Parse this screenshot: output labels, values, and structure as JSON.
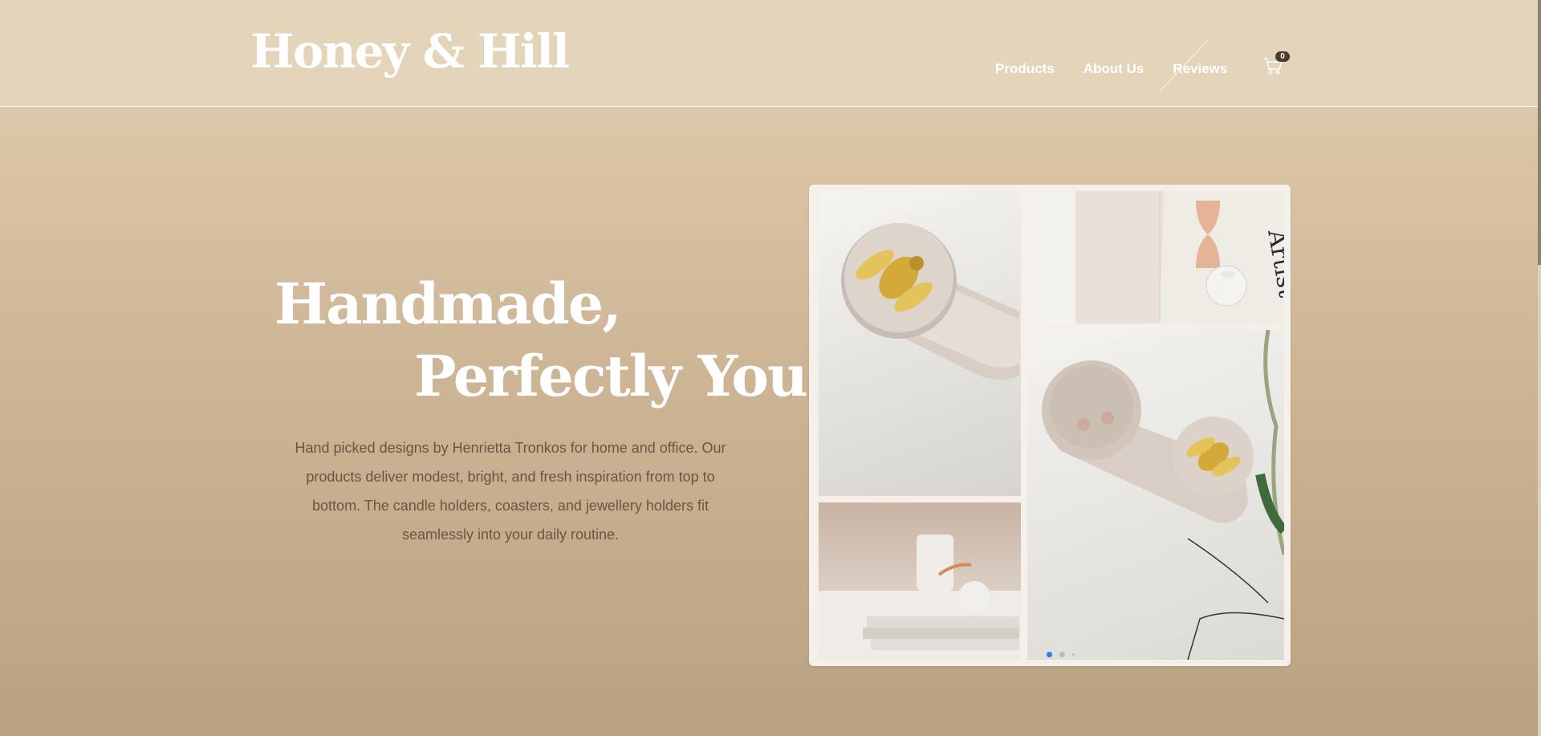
{
  "brand": {
    "logo_text": "Honey & Hill"
  },
  "nav": {
    "items": [
      {
        "label": "Products"
      },
      {
        "label": "About Us"
      },
      {
        "label": "Reviews"
      }
    ],
    "cart_count": "0"
  },
  "hero": {
    "title_line1": "Handmade,",
    "title_line2": "Perfectly You",
    "description": "Hand picked designs by Henrietta Tronkos for home and office. Our products deliver modest, bright, and fresh inspiration from top to bottom. The candle holders, coasters, and jewellery holders fit seamlessly into your daily routine."
  },
  "gallery": {
    "images": [
      {
        "icon": "bee-lid-jewellery-box-image"
      },
      {
        "icon": "hourglass-and-candle-image"
      },
      {
        "icon": "candle-on-books-image"
      },
      {
        "icon": "jewellery-box-with-earrings-image"
      }
    ],
    "slides": 3,
    "active_slide": 1
  },
  "colors": {
    "header_bg": "#e3d4ba",
    "text_white": "#ffffff",
    "desc_brown": "#6b5642",
    "dot_active": "#2b7de9"
  }
}
